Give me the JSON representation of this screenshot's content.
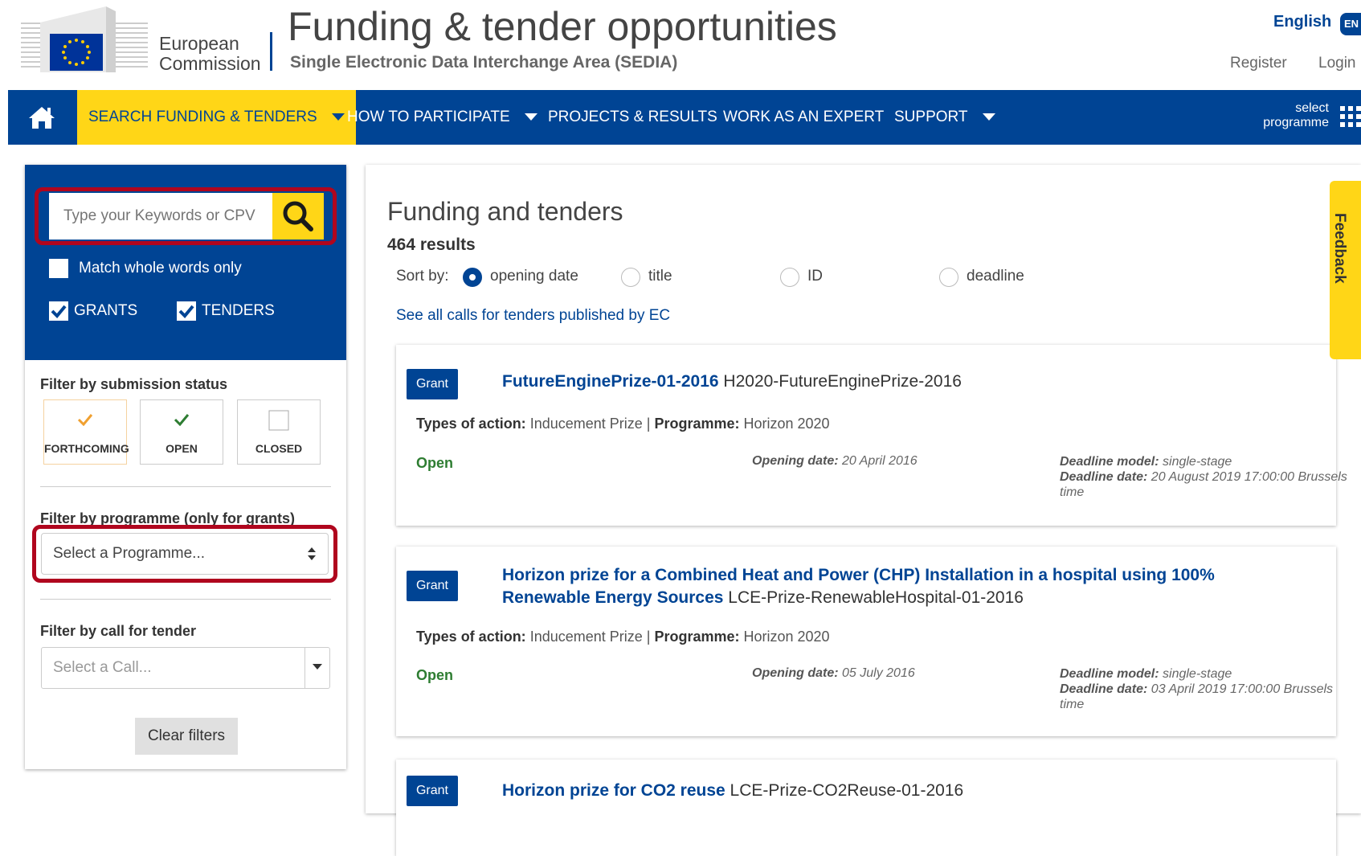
{
  "header": {
    "org_name": "European\nCommission",
    "title": "Funding & tender opportunities",
    "subtitle": "Single Electronic Data Interchange Area (SEDIA)",
    "language": "English",
    "language_code": "EN",
    "register": "Register",
    "login": "Login"
  },
  "nav": {
    "home_icon": "home-icon",
    "items": [
      {
        "label": "SEARCH FUNDING & TENDERS",
        "has_dropdown": true,
        "active": true
      },
      {
        "label": "HOW TO PARTICIPATE",
        "has_dropdown": true
      },
      {
        "label": "PROJECTS & RESULTS"
      },
      {
        "label": "WORK AS AN EXPERT"
      },
      {
        "label": "SUPPORT",
        "has_dropdown": true
      }
    ],
    "select_programme": "select\nprogramme",
    "grid_icon": "grid-icon"
  },
  "sidebar": {
    "search_placeholder": "Type your Keywords or CPV",
    "match_whole_words": "Match whole words only",
    "grants": "GRANTS",
    "tenders": "TENDERS",
    "filter_status_title": "Filter by submission status",
    "status": [
      {
        "label": "FORTHCOMING"
      },
      {
        "label": "OPEN"
      },
      {
        "label": "CLOSED"
      }
    ],
    "filter_programme_title": "Filter by programme (only for grants)",
    "programme_placeholder": "Select a Programme...",
    "filter_call_title": "Filter by call for tender",
    "call_placeholder": "Select a Call...",
    "clear_filters": "Clear filters"
  },
  "main": {
    "title": "Funding and tenders",
    "results": "464 results",
    "sort_by": "Sort by:",
    "sort_options": [
      "opening date",
      "title",
      "ID",
      "deadline"
    ],
    "see_all": "See all calls for tenders published by EC",
    "cards": [
      {
        "badge": "Grant",
        "title": "FutureEnginePrize-01-2016",
        "id": " H2020-FutureEnginePrize-2016",
        "types_label": "Types of action:",
        "types": " Inducement Prize | ",
        "programme_label": "Programme:",
        "programme": " Horizon 2020",
        "status": "Open",
        "opening_label": "Opening date:",
        "opening": " 20 April 2016",
        "deadline_model_label": "Deadline model:",
        "deadline_model": " single-stage",
        "deadline_date_label": "Deadline date:",
        "deadline_date": " 20 August 2019 17:00:00 Brussels time"
      },
      {
        "badge": "Grant",
        "title": "Horizon prize for a Combined Heat and Power (CHP) Installation in a hospital using 100% Renewable Energy Sources",
        "id": " LCE-Prize-RenewableHospital-01-2016",
        "types_label": "Types of action:",
        "types": " Inducement Prize | ",
        "programme_label": "Programme:",
        "programme": " Horizon 2020",
        "status": "Open",
        "opening_label": "Opening date:",
        "opening": " 05 July 2016",
        "deadline_model_label": "Deadline model:",
        "deadline_model": " single-stage",
        "deadline_date_label": "Deadline date:",
        "deadline_date": " 03 April 2019 17:00:00 Brussels time"
      },
      {
        "badge": "Grant",
        "title": "Horizon prize for CO2 reuse",
        "id": " LCE-Prize-CO2Reuse-01-2016"
      }
    ]
  },
  "feedback": "Feedback",
  "colors": {
    "primary": "#004494",
    "accent": "#ffd617",
    "highlight_ring": "#b0061e",
    "open_status": "#2e7d32"
  }
}
